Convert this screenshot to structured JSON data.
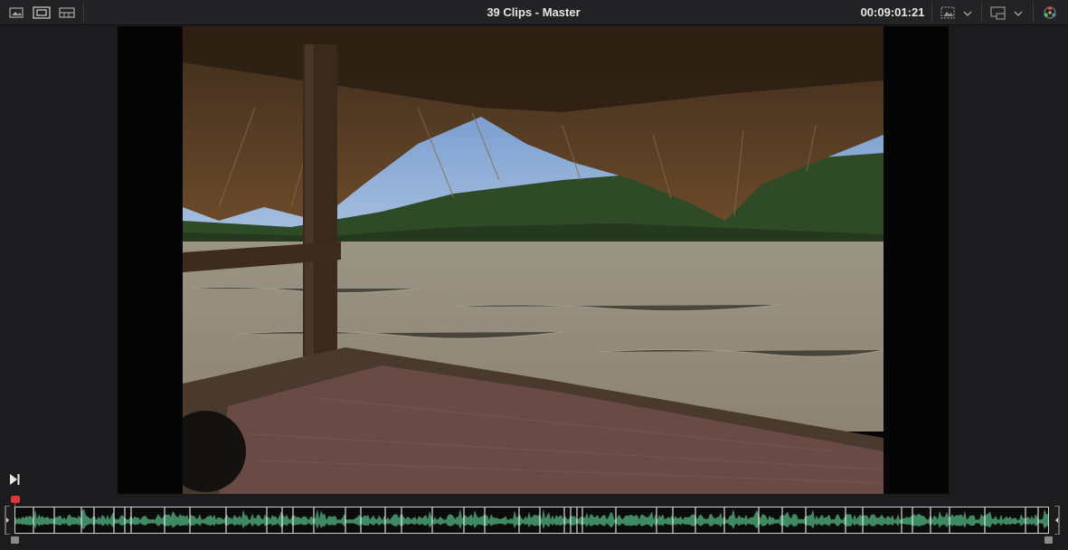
{
  "header": {
    "title": "39 Clips - Master",
    "timecode": "00:09:01:21"
  },
  "toolbar": {
    "left_icons": [
      "image-view-icon",
      "filmstrip-view-icon",
      "split-view-icon"
    ],
    "right_icons": [
      "viewer-mode-icon",
      "layout-icon",
      "color-wheel-icon"
    ]
  },
  "viewer": {
    "icons": [
      "play-to-end-icon"
    ]
  },
  "colors": {
    "background": "#1c1c1e",
    "topbar": "#232326",
    "viewer_letterbox": "#050505",
    "playhead": "#d83a3a",
    "waveform": "#3f8a63",
    "clip_boundary": "#ffffff"
  }
}
